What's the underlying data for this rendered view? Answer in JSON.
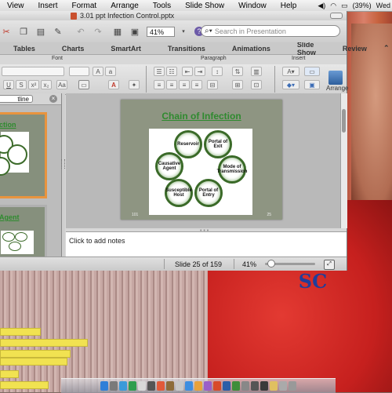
{
  "menubar": {
    "items": [
      "View",
      "Insert",
      "Format",
      "Arrange",
      "Tools",
      "Slide Show",
      "Window",
      "Help"
    ],
    "battery": "(39%)",
    "clock": "Wed"
  },
  "window": {
    "title": "3.01 ppt Infection Control.pptx"
  },
  "toolbar": {
    "zoom": "41%",
    "search_placeholder": "Search in Presentation"
  },
  "ribbon": {
    "tabs": [
      "Tables",
      "Charts",
      "SmartArt",
      "Transitions",
      "Animations",
      "Slide Show",
      "Review"
    ],
    "groups": {
      "font": "Font",
      "paragraph": "Paragraph",
      "insert": "Insert"
    },
    "arrange_label": "Arrange"
  },
  "left_pane": {
    "outline_tab": "tline",
    "thumb1_title": "ction",
    "thumb2_title": "Agent"
  },
  "slide": {
    "title": "Chain of Infection",
    "nodes": {
      "reservoir": "Reservoir",
      "portal_exit": "Portal of Exit",
      "mode": "Mode of Transmission",
      "portal_entry": "Portal of Entry",
      "host": "Susceptible Host",
      "agent": "Causative Agent"
    },
    "footer_left": "101",
    "footer_right": "25"
  },
  "notes": {
    "placeholder": "Click to add notes"
  },
  "status": {
    "slide": "Slide 25 of 159",
    "zoom": "41%",
    "zoom_slider_level": 0.05
  },
  "background": {
    "logo_text": "SC"
  }
}
